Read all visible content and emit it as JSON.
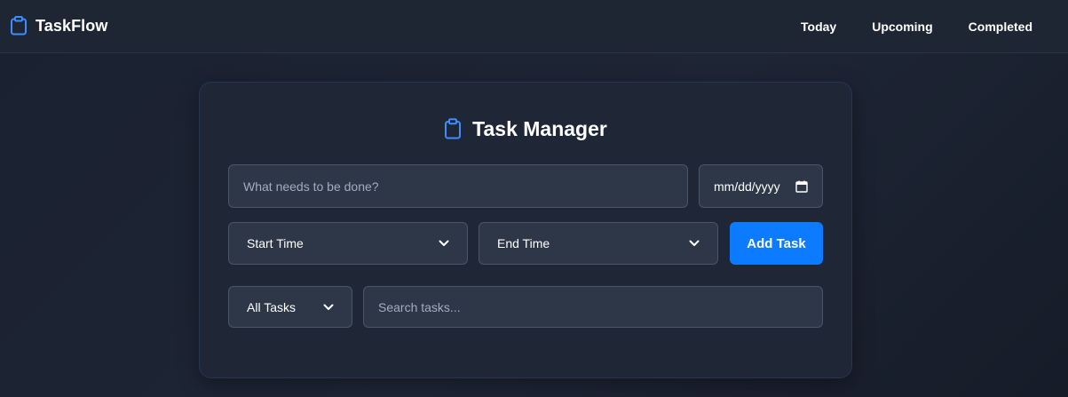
{
  "app": {
    "brand_name": "TaskFlow",
    "brand_icon": "clipboard-icon"
  },
  "nav": {
    "items": [
      {
        "label": "Today"
      },
      {
        "label": "Upcoming"
      },
      {
        "label": "Completed"
      }
    ]
  },
  "card": {
    "title": "Task Manager",
    "title_icon": "clipboard-icon"
  },
  "form": {
    "task_placeholder": "What needs to be done?",
    "date_placeholder": "mm/dd/yyyy",
    "start_time_label": "Start Time",
    "end_time_label": "End Time",
    "add_button_label": "Add Task",
    "filter_selected": "All Tasks",
    "search_placeholder": "Search tasks..."
  },
  "colors": {
    "accent": "#0d7bff",
    "icon_blue": "#3b8eff",
    "background": "#1a2130",
    "card_background": "#1f2736",
    "field_background": "#2d3748"
  }
}
